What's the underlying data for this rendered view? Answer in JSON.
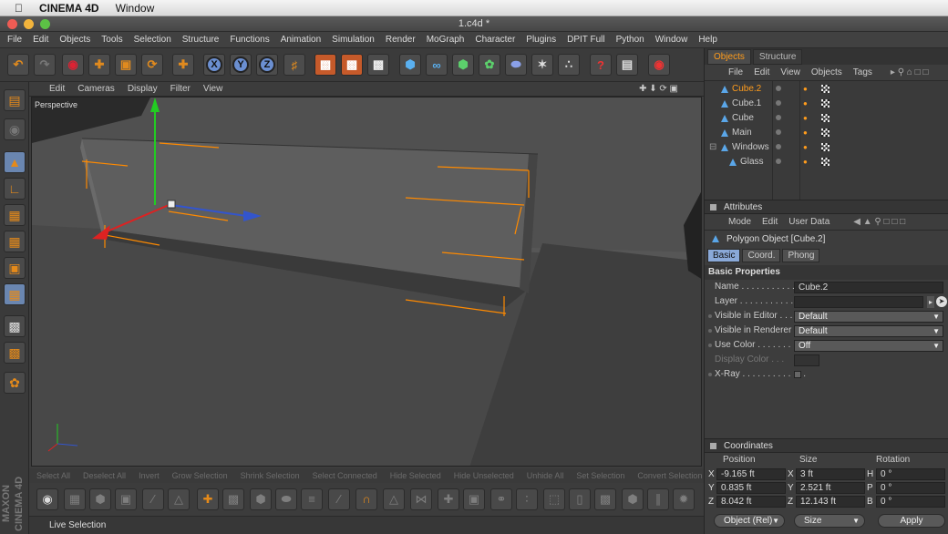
{
  "menubar": {
    "app_name": "CINEMA 4D",
    "window": "Window"
  },
  "window": {
    "title": "1.c4d *"
  },
  "main_menu": [
    "File",
    "Edit",
    "Objects",
    "Tools",
    "Selection",
    "Structure",
    "Functions",
    "Animation",
    "Simulation",
    "Render",
    "MoGraph",
    "Character",
    "Plugins",
    "DPIT Full",
    "Python",
    "Window",
    "Help"
  ],
  "toolbar": {
    "axis_x": "X",
    "axis_y": "Y",
    "axis_z": "Z"
  },
  "viewport": {
    "menu": [
      "Edit",
      "Cameras",
      "Display",
      "Filter",
      "View"
    ],
    "label": "Perspective"
  },
  "command_bar": [
    "Select All",
    "Deselect All",
    "Invert",
    "Grow Selection",
    "Shrink Selection",
    "Select Connected",
    "Hide Selected",
    "Hide Unselected",
    "Unhide All",
    "Set Selection",
    "Convert Selection"
  ],
  "status": {
    "text": "Live Selection"
  },
  "brand": {
    "text": "MAXON CINEMA 4D"
  },
  "objects_panel": {
    "tabs": [
      "Objects",
      "Structure"
    ],
    "menu": [
      "File",
      "Edit",
      "View",
      "Objects",
      "Tags"
    ],
    "items": [
      {
        "name": "Cube.2",
        "selected": true
      },
      {
        "name": "Cube.1"
      },
      {
        "name": "Cube"
      },
      {
        "name": "Main"
      },
      {
        "name": "Windows"
      },
      {
        "name": "Glass"
      }
    ]
  },
  "attributes": {
    "title": "Attributes",
    "menu": [
      "Mode",
      "Edit",
      "User Data"
    ],
    "object_label": "Polygon Object [Cube.2]",
    "tabs": [
      "Basic",
      "Coord.",
      "Phong"
    ],
    "section": "Basic Properties",
    "props": {
      "name_label": "Name . . . . . . . . . . . . .",
      "name_value": "Cube.2",
      "layer_label": "Layer . . . . . . . . . . . . .",
      "vis_editor_label": "Visible in Editor . . .",
      "vis_editor_value": "Default",
      "vis_render_label": "Visible in Renderer",
      "vis_render_value": "Default",
      "use_color_label": "Use Color . . . . . . . .",
      "use_color_value": "Off",
      "display_color_label": "Display Color . . .",
      "xray_label": "X-Ray . . . . . . . . . . . . ."
    }
  },
  "coordinates": {
    "title": "Coordinates",
    "headers": {
      "position": "Position",
      "size": "Size",
      "rotation": "Rotation"
    },
    "rows": [
      {
        "axis": "X",
        "pos": "-9.165 ft",
        "size_axis": "X",
        "size": "3 ft",
        "rot_axis": "H",
        "rot": "0 °"
      },
      {
        "axis": "Y",
        "pos": "0.835 ft",
        "size_axis": "Y",
        "size": "2.521 ft",
        "rot_axis": "P",
        "rot": "0 °"
      },
      {
        "axis": "Z",
        "pos": "8.042 ft",
        "size_axis": "Z",
        "size": "12.143 ft",
        "rot_axis": "B",
        "rot": "0 °"
      }
    ],
    "mode": "Object (Rel)",
    "size_mode": "Size",
    "apply": "Apply"
  }
}
